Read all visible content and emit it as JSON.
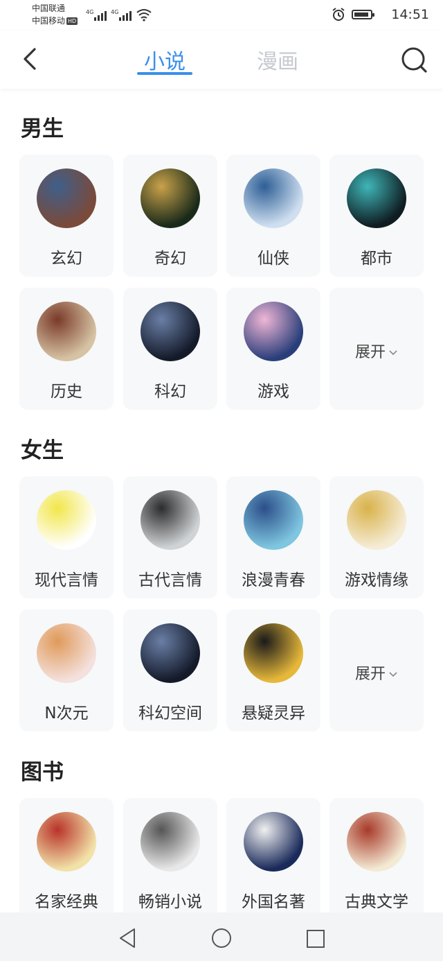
{
  "status": {
    "carrier1": "中国联通",
    "carrier2": "中国移动",
    "hd": "HD",
    "net": "4G",
    "time": "14:51"
  },
  "header": {
    "tab_novel": "小说",
    "tab_comic": "漫画"
  },
  "sections": [
    {
      "title": "男生",
      "items": [
        {
          "label": "玄幻",
          "thumb": [
            "#7a4a3a",
            "#3f5f8a"
          ]
        },
        {
          "label": "奇幻",
          "thumb": [
            "#1a2a1a",
            "#c9a24a"
          ]
        },
        {
          "label": "仙侠",
          "thumb": [
            "#cfdff0",
            "#2e5f96"
          ]
        },
        {
          "label": "都市",
          "thumb": [
            "#0f1d22",
            "#3fb6b8"
          ]
        },
        {
          "label": "历史",
          "thumb": [
            "#d6c3a4",
            "#7a3a2a"
          ]
        },
        {
          "label": "科幻",
          "thumb": [
            "#141a2a",
            "#6a7fa6"
          ]
        },
        {
          "label": "游戏",
          "thumb": [
            "#2a3f7a",
            "#f0b6d6"
          ]
        }
      ],
      "expand": "展开"
    },
    {
      "title": "女生",
      "items": [
        {
          "label": "现代言情",
          "thumb": [
            "#ffffff",
            "#f2e64a"
          ]
        },
        {
          "label": "古代言情",
          "thumb": [
            "#d0d3d6",
            "#2c2c2c"
          ]
        },
        {
          "label": "浪漫青春",
          "thumb": [
            "#7fc6e0",
            "#2c4f8a"
          ]
        },
        {
          "label": "游戏情缘",
          "thumb": [
            "#f5ecd6",
            "#d9b24a"
          ]
        },
        {
          "label": "N次元",
          "thumb": [
            "#f4e0dc",
            "#e09a5a"
          ]
        },
        {
          "label": "科幻空间",
          "thumb": [
            "#141a2a",
            "#6a7fa6"
          ]
        },
        {
          "label": "悬疑灵异",
          "thumb": [
            "#e6b83a",
            "#1a1a1a"
          ]
        }
      ],
      "expand": "展开"
    },
    {
      "title": "图书",
      "items": [
        {
          "label": "名家经典",
          "thumb": [
            "#f2e2a8",
            "#b8332a"
          ]
        },
        {
          "label": "畅销小说",
          "thumb": [
            "#e8e8e8",
            "#555555"
          ]
        },
        {
          "label": "外国名著",
          "thumb": [
            "#1a2a5a",
            "#f0f0f0"
          ]
        },
        {
          "label": "古典文学",
          "thumb": [
            "#f3ead4",
            "#a83a2a"
          ]
        }
      ]
    }
  ]
}
